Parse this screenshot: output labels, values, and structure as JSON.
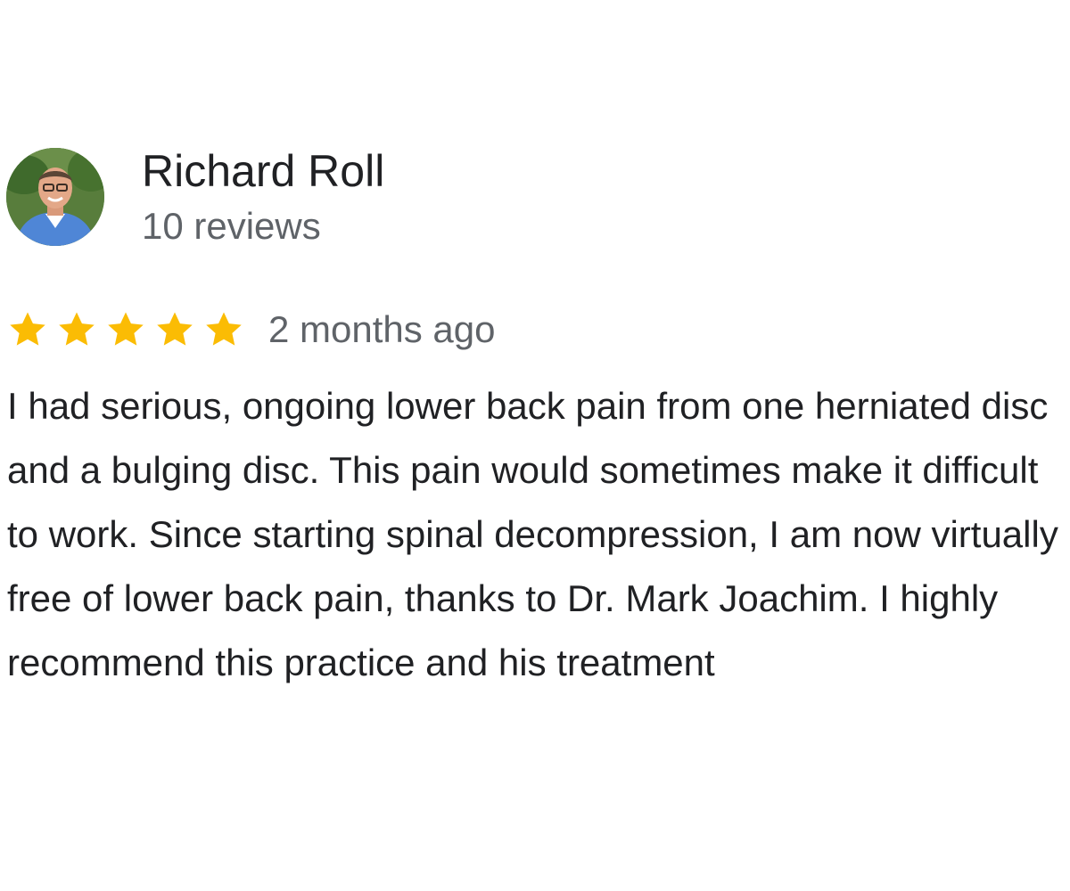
{
  "review": {
    "reviewer_name": "Richard Roll",
    "review_count": "10 reviews",
    "rating": 5,
    "rating_max": 5,
    "date": "2 months ago",
    "text": "I had serious, ongoing lower back pain from one herniated disc and a bulging disc. This pain would sometimes make it difficult to work. Since starting spinal decompression, I am now virtually free of lower back pain, thanks to Dr. Mark Joachim. I highly recommend this practice and his treatment"
  },
  "colors": {
    "star": "#fbbc04",
    "name_text": "#202124",
    "secondary_text": "#5f6368",
    "body_text": "#202124"
  },
  "icons": {
    "avatar": "reviewer-profile-photo",
    "star": "star-icon"
  }
}
